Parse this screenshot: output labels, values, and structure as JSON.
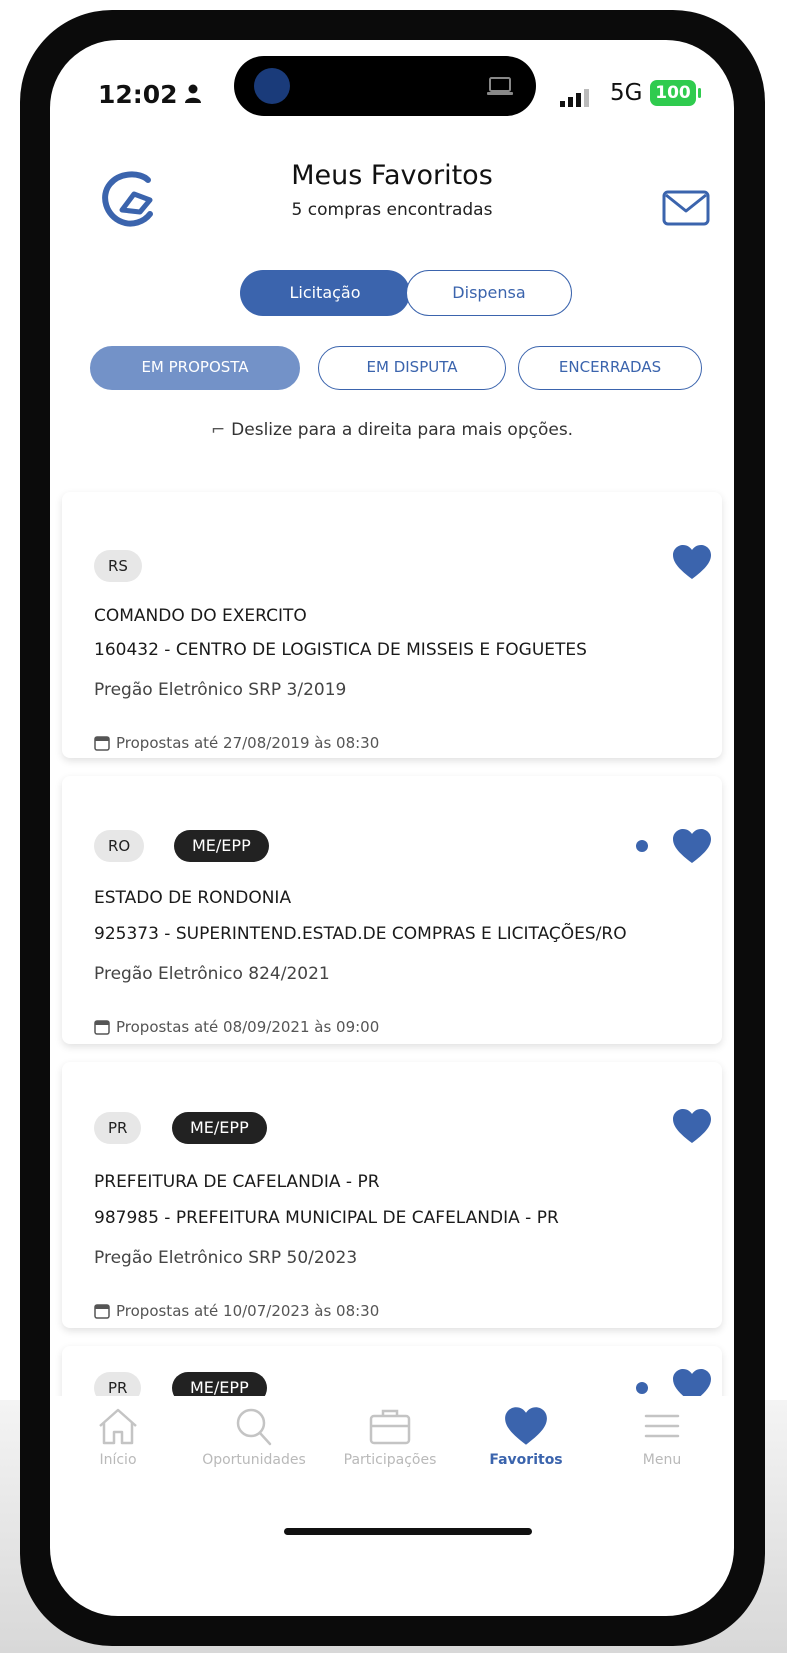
{
  "status": {
    "time": "12:02",
    "network": "5G",
    "battery": "100"
  },
  "header": {
    "title": "Meus Favoritos",
    "subtitle": "5 compras encontradas"
  },
  "segments": {
    "licitacao": "Licitação",
    "dispensa": "Dispensa"
  },
  "tabs": {
    "proposta": "EM PROPOSTA",
    "disputa": "EM DISPUTA",
    "encerradas": "ENCERRADAS"
  },
  "hint": "Deslize para a direita para mais opções.",
  "cards": [
    {
      "state": "RS",
      "me": "",
      "org": "COMANDO DO EXERCITO",
      "unit": "160432 - CENTRO DE LOGISTICA DE MISSEIS E FOGUETES",
      "mode": "Pregão Eletrônico SRP 3/2019",
      "deadline": "Propostas até 27/08/2019 às 08:30"
    },
    {
      "state": "RO",
      "me": "ME/EPP",
      "org": "ESTADO DE RONDONIA",
      "unit": "925373 - SUPERINTEND.ESTAD.DE COMPRAS E LICITAÇÕES/RO",
      "mode": "Pregão Eletrônico 824/2021",
      "deadline": "Propostas até 08/09/2021 às 09:00"
    },
    {
      "state": "PR",
      "me": "ME/EPP",
      "org": "PREFEITURA DE CAFELANDIA - PR",
      "unit": "987985 - PREFEITURA MUNICIPAL DE CAFELANDIA - PR",
      "mode": "Pregão Eletrônico SRP 50/2023",
      "deadline": "Propostas até 10/07/2023 às 08:30"
    },
    {
      "state": "PR",
      "me": "ME/EPP"
    }
  ],
  "nav": {
    "inicio": "Início",
    "oportunidades": "Oportunidades",
    "participacoes": "Participações",
    "favoritos": "Favoritos",
    "menu": "Menu"
  },
  "colors": {
    "accent": "#3b64ad",
    "active_tab": "#7392c8",
    "battery": "#2fcb4e"
  }
}
